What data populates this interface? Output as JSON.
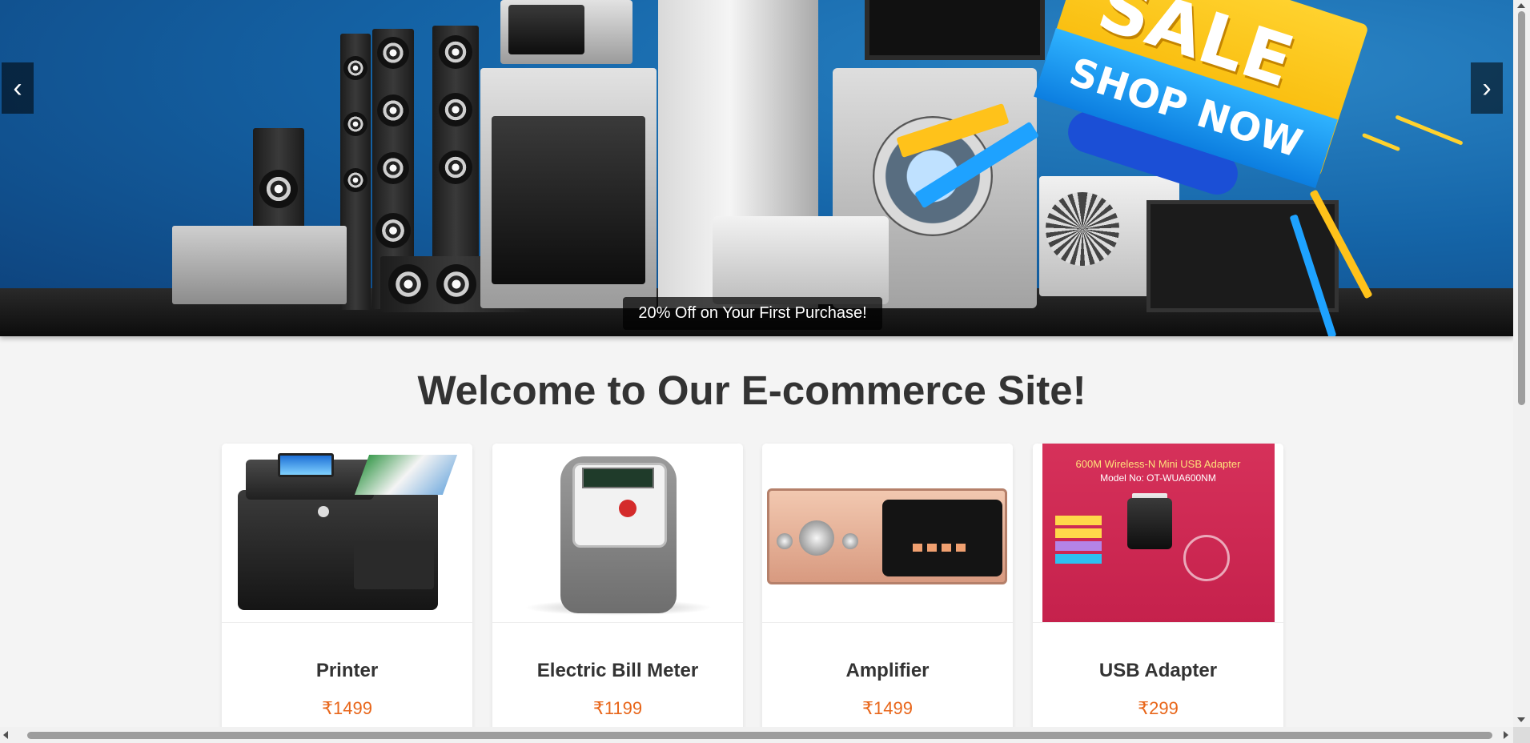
{
  "banner": {
    "prev_icon": "‹",
    "next_icon": "›",
    "caption": "20% Off on Your First Purchase!",
    "sale_text": "SALE",
    "shop_now": "SHOP NOW"
  },
  "main": {
    "title": "Welcome to Our E-commerce Site!"
  },
  "products": [
    {
      "name": "Printer",
      "price": "₹1499",
      "image": "printer"
    },
    {
      "name": "Electric Bill Meter",
      "price": "₹1199",
      "image": "electric-meter"
    },
    {
      "name": "Amplifier",
      "price": "₹1499",
      "image": "amplifier"
    },
    {
      "name": "USB Adapter",
      "price": "₹299",
      "image": "usb-adapter"
    }
  ],
  "usb_packaging": {
    "headline": "600M Wireless-N Mini USB Adapter",
    "model": "Model No: OT-WUA600NM"
  },
  "colors": {
    "price": "#e8661a",
    "title": "#333333",
    "banner_blue": "#1565a8",
    "sale_yellow": "#ffd22e"
  }
}
